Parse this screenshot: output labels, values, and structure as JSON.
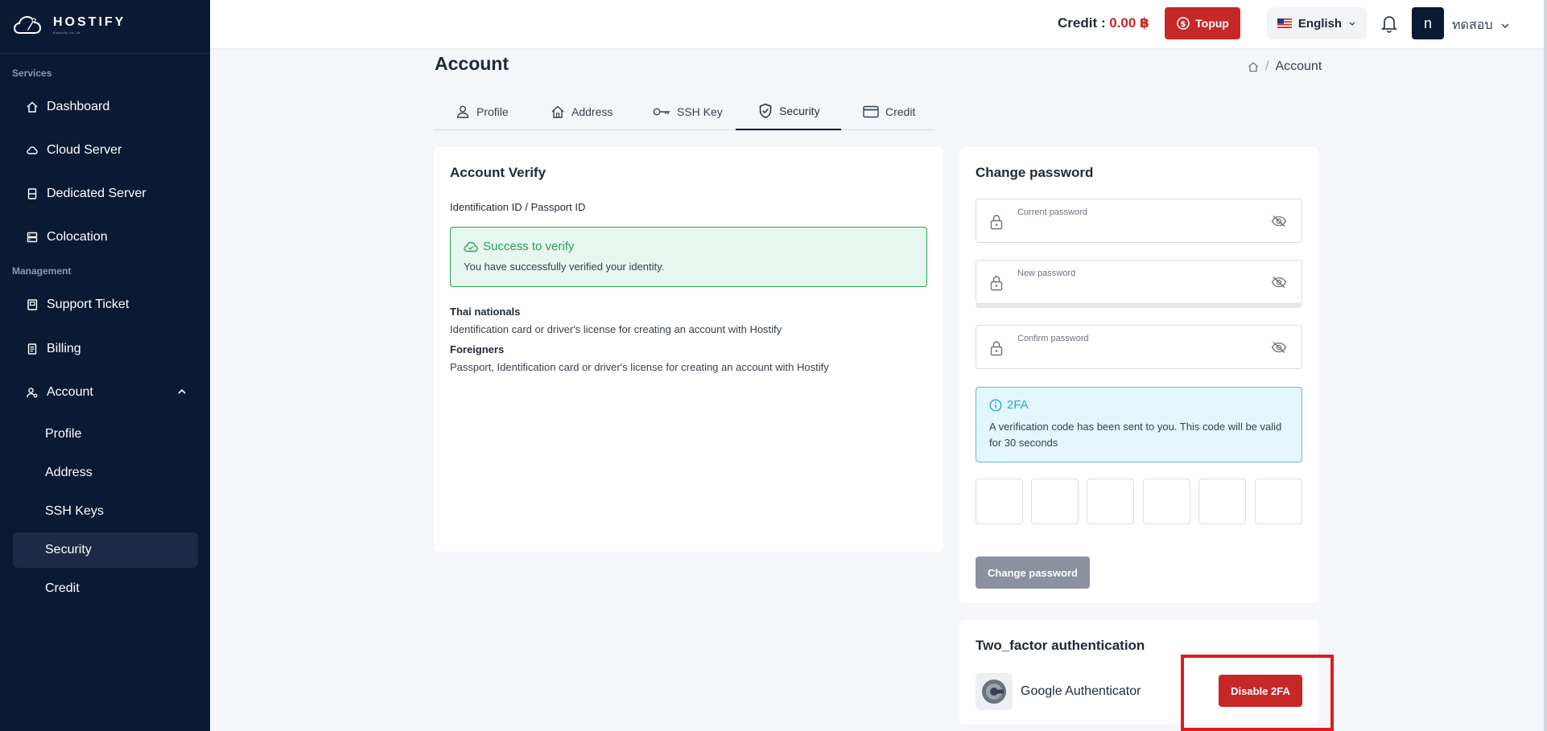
{
  "brand": {
    "name": "HOSTIFY",
    "tagline": "hostify.co.th"
  },
  "sidebar": {
    "sections": {
      "services": "Services",
      "management": "Management"
    },
    "services": [
      {
        "label": "Dashboard",
        "icon": "home-icon"
      },
      {
        "label": "Cloud Server",
        "icon": "cloud-icon"
      },
      {
        "label": "Dedicated Server",
        "icon": "server-icon"
      },
      {
        "label": "Colocation",
        "icon": "colocation-icon"
      }
    ],
    "management": [
      {
        "label": "Support Ticket",
        "icon": "ticket-icon"
      },
      {
        "label": "Billing",
        "icon": "billing-icon"
      },
      {
        "label": "Account",
        "icon": "account-icon",
        "expanded": true
      }
    ],
    "account_sub": [
      "Profile",
      "Address",
      "SSH Keys",
      "Security",
      "Credit"
    ],
    "active_sub": "Security"
  },
  "header": {
    "credit_label": "Credit :",
    "credit_amount": "0.00 ฿",
    "topup_label": "Topup",
    "language": "English",
    "avatar_letter": "n",
    "username": "ทดสอบ"
  },
  "page": {
    "title": "Account",
    "breadcrumb": [
      "Account"
    ],
    "tabs": [
      "Profile",
      "Address",
      "SSH Key",
      "Security",
      "Credit"
    ],
    "active_tab": "Security"
  },
  "verify": {
    "title": "Account Verify",
    "field_label": "Identification ID / Passport ID",
    "status_title": "Success to verify",
    "status_text": "You have successfully verified your identity.",
    "thai_heading": "Thai nationals",
    "thai_text": "Identification card or driver's license for creating an account with Hostify",
    "foreign_heading": "Foreigners",
    "foreign_text": "Passport, Identification card or driver's license for creating an account with Hostify"
  },
  "password": {
    "title": "Change password",
    "current_label": "Current password",
    "new_label": "New password",
    "confirm_label": "Confirm password",
    "twofa_title": "2FA",
    "twofa_text": "A verification code has been sent to you. This code will be valid for 30 seconds",
    "otp_digits": [
      "",
      "",
      "",
      "",
      "",
      ""
    ],
    "submit_label": "Change password"
  },
  "two_factor": {
    "title": "Two_factor authentication",
    "provider": "Google Authenticator",
    "disable_label": "Disable 2FA"
  },
  "colors": {
    "sidebar": "#0b1a33",
    "accent_red": "#c62828",
    "success": "#2e9c5b",
    "info": "#2aa7c9"
  }
}
